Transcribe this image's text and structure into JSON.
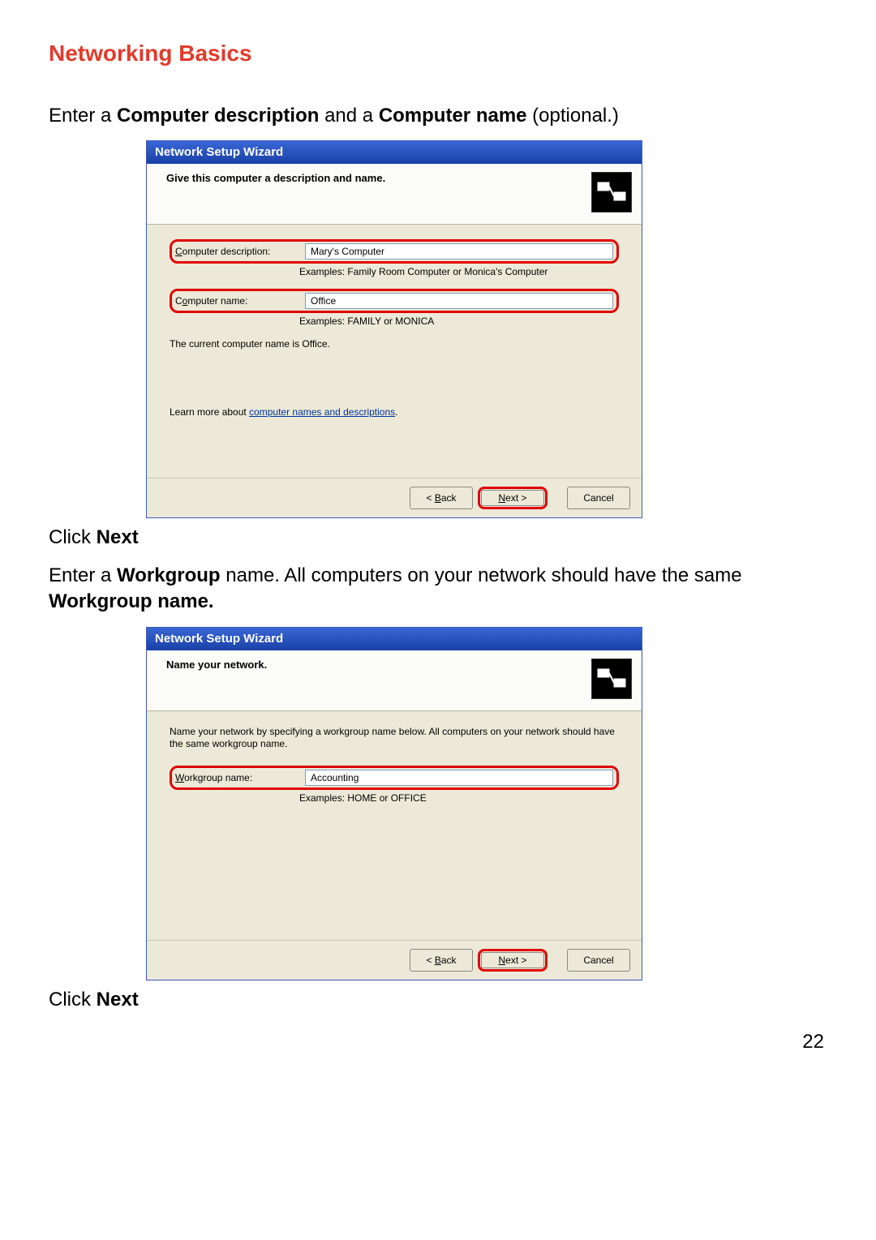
{
  "heading": "Networking Basics",
  "instr1_pre": "Enter a ",
  "instr1_b1": "Computer description",
  "instr1_mid": " and a ",
  "instr1_b2": "Computer name",
  "instr1_post": " (optional.)",
  "click_next_pre": "Click ",
  "click_next_b": "Next",
  "instr2_pre": "Enter a ",
  "instr2_b1": "Workgroup",
  "instr2_mid": " name.  All computers on your network should have the same ",
  "instr2_b2": "Workgroup name.",
  "pagenum": "22",
  "dlg1": {
    "title": "Network Setup Wizard",
    "header": "Give this computer a description and name.",
    "desc_label_u": "C",
    "desc_label_rest": "omputer description:",
    "desc_value": "Mary's Computer",
    "desc_example": "Examples: Family Room Computer or Monica's Computer",
    "name_label_pre": "C",
    "name_label_u": "o",
    "name_label_rest": "mputer name:",
    "name_value": "Office",
    "name_example": "Examples: FAMILY or MONICA",
    "current": "The current computer name is Office.",
    "learn_pre": "Learn more about ",
    "learn_link": "computer names and descriptions",
    "learn_post": ".",
    "back_pre": "< ",
    "back_u": "B",
    "back_rest": "ack",
    "next_u": "N",
    "next_rest": "ext >",
    "cancel": "Cancel"
  },
  "dlg2": {
    "title": "Network Setup Wizard",
    "header": "Name your network.",
    "desc": "Name your network by specifying a workgroup name below. All computers on your network should have the same workgroup name.",
    "wg_label_u": "W",
    "wg_label_rest": "orkgroup name:",
    "wg_value": "Accounting",
    "wg_example": "Examples: HOME or OFFICE",
    "back_pre": "< ",
    "back_u": "B",
    "back_rest": "ack",
    "next_u": "N",
    "next_rest": "ext >",
    "cancel": "Cancel"
  }
}
